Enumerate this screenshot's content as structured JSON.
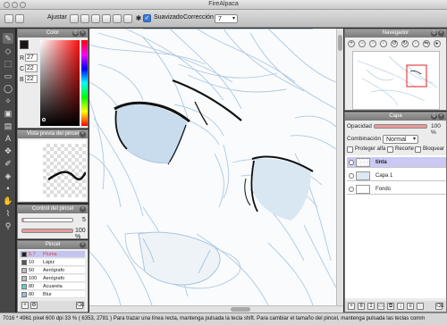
{
  "window": {
    "title": "FireAlpaca"
  },
  "toolbar": {
    "ajustar_label": "Ajustar",
    "suavizado_label": "Suavizado",
    "correccion_label": "Corrección",
    "correccion_value": "7"
  },
  "color_panel": {
    "title": "Color",
    "r_label": "R",
    "r_value": "27",
    "g_label": "C",
    "g_value": "22",
    "b_label": "B",
    "b_value": "22",
    "primary_color": "#1b1616"
  },
  "brush_preview": {
    "title": "Vista previa del pincel"
  },
  "brush_control": {
    "title": "Control del pincel",
    "size_value": "5",
    "opacity_value": "100 %"
  },
  "brush_panel": {
    "title": "Pincel",
    "items": [
      {
        "size": "5.7",
        "name": "Pluma",
        "color": "#d44444",
        "selected": true
      },
      {
        "size": "10",
        "name": "Lápiz",
        "color": "#555555"
      },
      {
        "size": "50",
        "name": "Aerógrafo",
        "color": "#bbbbbb"
      },
      {
        "size": "100",
        "name": "Aerógrafo",
        "color": "#bbbbbb"
      },
      {
        "size": "80",
        "name": "Acuarela",
        "color": "#66cccc"
      },
      {
        "size": "80",
        "name": "Blur",
        "color": "#99bbdd"
      }
    ]
  },
  "navigator": {
    "title": "Navegador"
  },
  "layer_panel": {
    "title": "Capa",
    "opacity_label": "Opacidad",
    "opacity_value": "100 %",
    "blend_label": "Combinación",
    "blend_value": "Normal",
    "protect_alpha_label": "Proteger alfa",
    "clip_label": "Recorte",
    "lock_label": "Bloquear",
    "layers": [
      {
        "name": "tinta",
        "selected": true
      },
      {
        "name": "Capa 1"
      },
      {
        "name": "Fondo"
      }
    ]
  },
  "status": {
    "text": "7016 * 4961 pixel   600 dpi   33 %  ( 6353, 2781 )   Para trazar una línea recta, mantenga pulsada la tecla shift. Para cambiar el tamaño del pincel, mantenga pulsada las teclas comm"
  },
  "colors": {
    "sketch_blue": "#a9c6e0",
    "ink": "#111111",
    "fill_blue": "#c9dcee",
    "accent_red": "#e06060"
  }
}
